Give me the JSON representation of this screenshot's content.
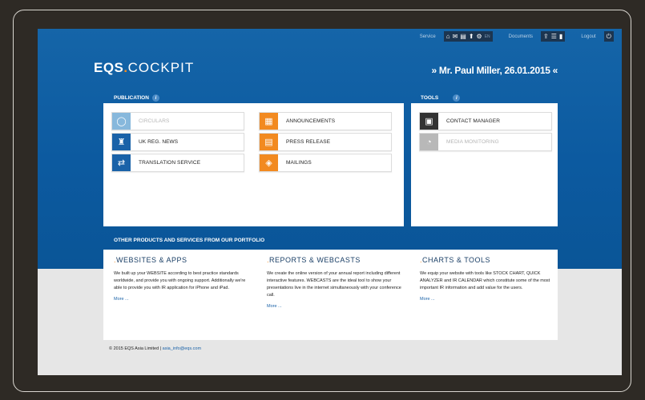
{
  "topbar": {
    "service_label": "Service",
    "service_icons": [
      "home-icon",
      "envelope-icon",
      "document-icon",
      "upload-icon",
      "gear-icon"
    ],
    "lang": "EN",
    "documents_label": "Documents",
    "documents_icons": [
      "folder-upload-icon",
      "list-icon",
      "document-icon"
    ],
    "logout_label": "Logout",
    "logout_icon": "power-icon"
  },
  "logo": {
    "part1": "EQS",
    "dot": ".",
    "part2": "COCKPIT"
  },
  "greeting": "» Mr. Paul Miller, 26.01.2015 «",
  "publication": {
    "title": "PUBLICATION",
    "info": "i",
    "tiles": [
      {
        "label": "CIRCULARS",
        "icon": "circle-icon",
        "color": "#87b8dc",
        "disabled": true
      },
      {
        "label": "UK REG. NEWS",
        "icon": "london-skyline-icon",
        "color": "#1a62a8",
        "disabled": false
      },
      {
        "label": "TRANSLATION SERVICE",
        "icon": "swap-arrows-icon",
        "color": "#1a62a8",
        "disabled": false
      },
      {
        "label": "ANNOUNCEMENTS",
        "icon": "building-icon",
        "color": "#f28a20",
        "disabled": false
      },
      {
        "label": "PRESS RELEASE",
        "icon": "newspaper-icon",
        "color": "#f28a20",
        "disabled": false
      },
      {
        "label": "MAILINGS",
        "icon": "tag-icon",
        "color": "#f28a20",
        "disabled": false
      }
    ]
  },
  "tools": {
    "title": "TOOLS",
    "info": "i",
    "tiles": [
      {
        "label": "CONTACT MANAGER",
        "icon": "contact-card-icon",
        "color": "#333333",
        "disabled": false
      },
      {
        "label": "MEDIA MONITORING",
        "icon": "chart-icon",
        "color": "#b8b8b8",
        "disabled": true
      }
    ]
  },
  "portfolio": {
    "title": "OTHER PRODUCTS AND SERVICES FROM OUR PORTFOLIO",
    "columns": [
      {
        "title": "WEBSITES & APPS",
        "text": "We built up your WEBSITE according to best practice standards worldwide, and provide you with ongoing support. Additionally we're able to provide you with IR application for iPhone and iPad.",
        "more": "More ..."
      },
      {
        "title": "REPORTS & WEBCASTS",
        "text": "We create the online version of your annual report including different interactive features. WEBCASTS are the ideal tool to show your presentations live in the internet simultaneously with your conference call.",
        "more": "More ..."
      },
      {
        "title": "CHARTS & TOOLS",
        "text": "We equip your website with tools like STOCK CHART, QUICK ANALYZER and IR CALENDAR which constitute some of the most important IR information and add value for the users.",
        "more": "More ..."
      }
    ]
  },
  "footer": {
    "copyright": "© 2015 EQS Asia Limited |",
    "email": "asia_info@eqs.com"
  },
  "colors": {
    "brand_blue": "#0c5aa0",
    "accent_orange": "#f28a20",
    "frame_bg": "#2e2a25"
  }
}
